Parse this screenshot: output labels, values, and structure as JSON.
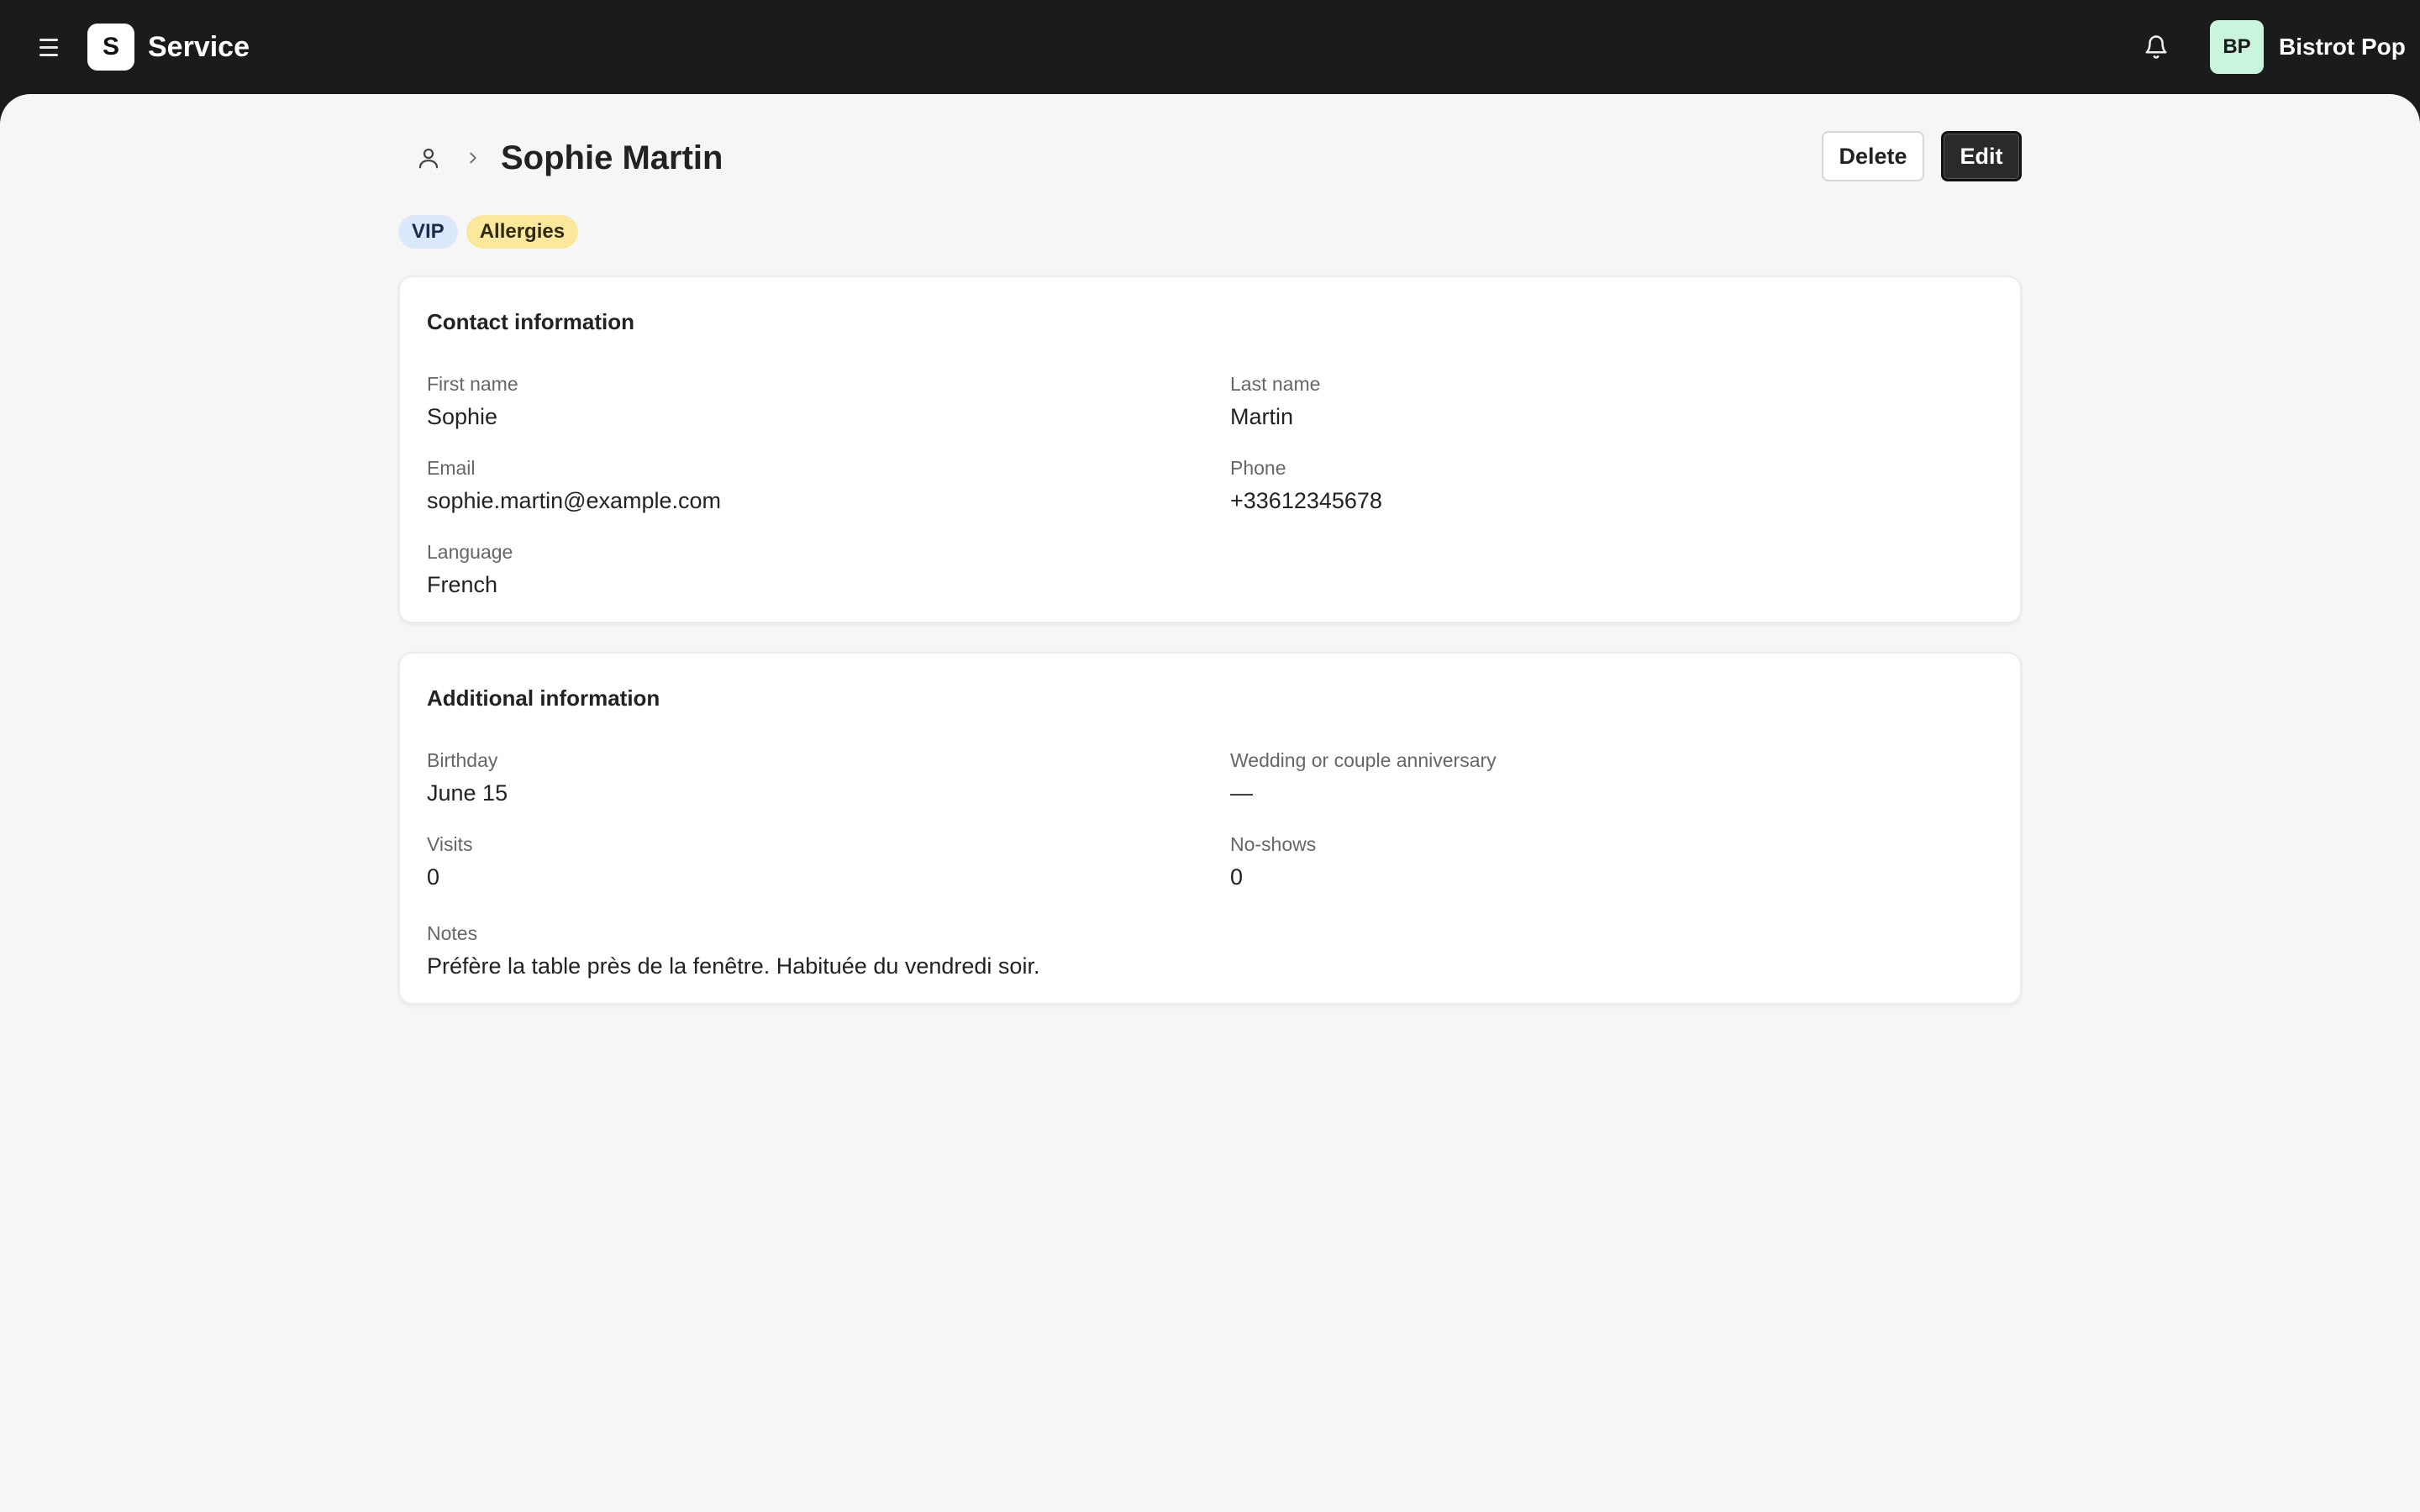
{
  "app": {
    "logo_letter": "S",
    "name": "Service"
  },
  "account": {
    "initials": "BP",
    "name": "Bistrot Pop"
  },
  "icons": {
    "menu": "menu-icon",
    "bell": "bell-icon",
    "person": "person-icon",
    "chevron": "chevron-right-icon"
  },
  "page": {
    "title": "Sophie Martin"
  },
  "actions": {
    "delete_label": "Delete",
    "edit_label": "Edit"
  },
  "tags": [
    {
      "label": "VIP",
      "color": "#dbe8fb"
    },
    {
      "label": "Allergies",
      "color": "#fbe89a"
    }
  ],
  "contact": {
    "title": "Contact information",
    "first_name": {
      "label": "First name",
      "value": "Sophie"
    },
    "last_name": {
      "label": "Last name",
      "value": "Martin"
    },
    "email": {
      "label": "Email",
      "value": "sophie.martin@example.com"
    },
    "phone": {
      "label": "Phone",
      "value": "+33612345678"
    },
    "language": {
      "label": "Language",
      "value": "French"
    }
  },
  "additional": {
    "title": "Additional information",
    "birthday": {
      "label": "Birthday",
      "value": "June 15"
    },
    "anniversary": {
      "label": "Wedding or couple anniversary",
      "value": "—"
    },
    "visits": {
      "label": "Visits",
      "value": "0"
    },
    "no_shows": {
      "label": "No-shows",
      "value": "0"
    },
    "notes": {
      "label": "Notes",
      "value": "Préfère la table près de la fenêtre. Habituée du vendredi soir."
    }
  }
}
